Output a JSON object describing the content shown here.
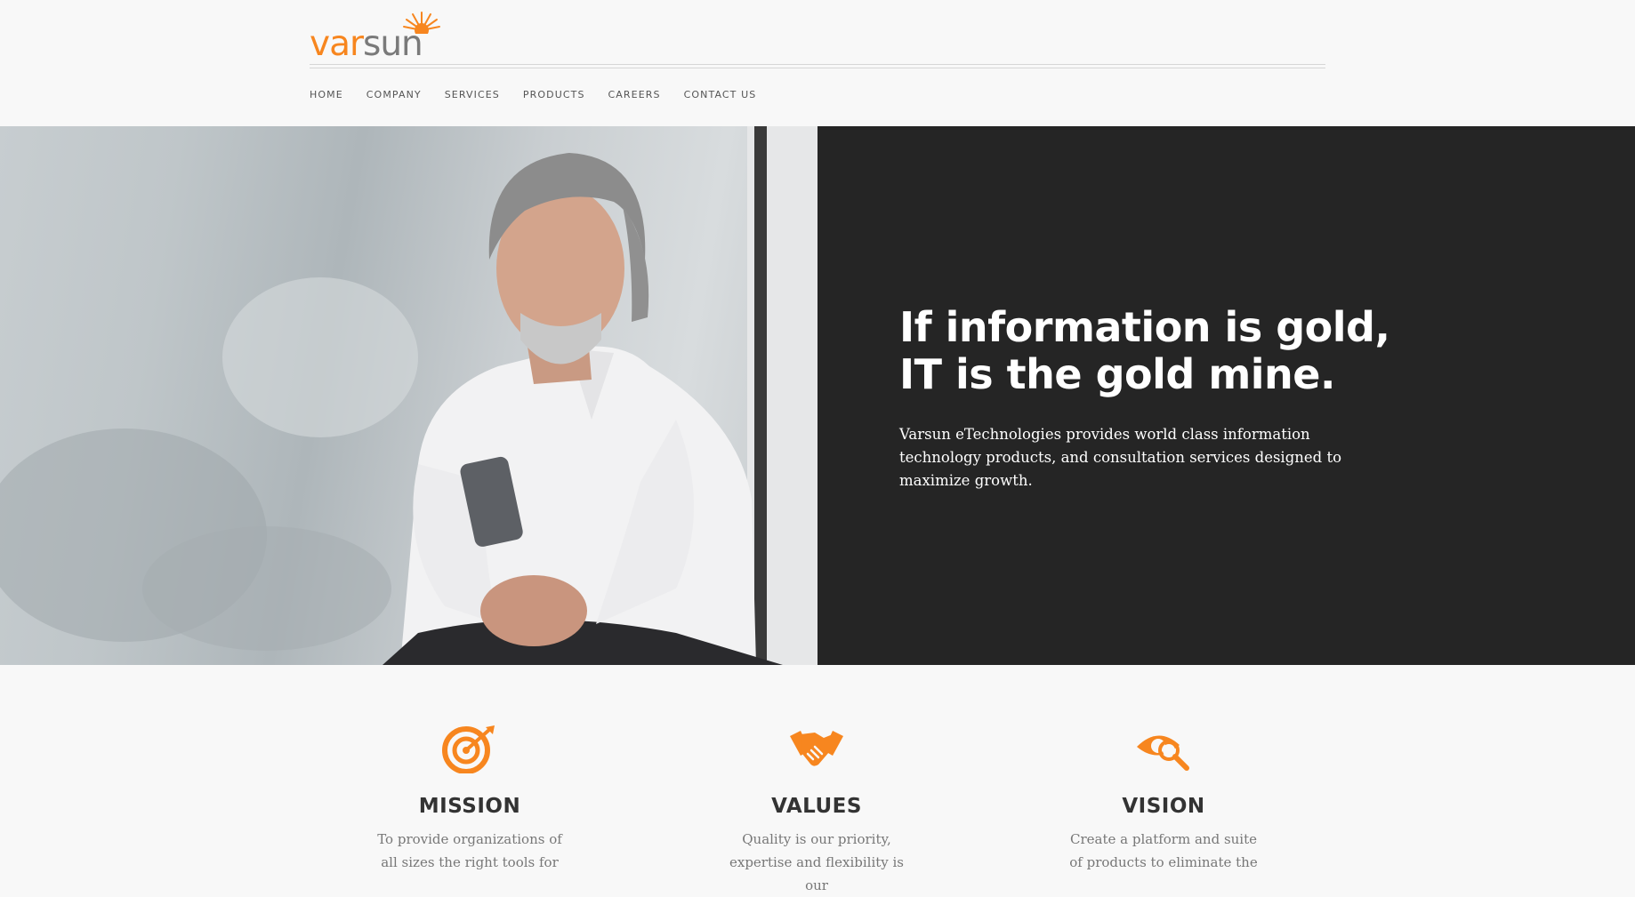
{
  "brand": {
    "logo_part1": "var",
    "logo_part2": "sun",
    "accent_color": "#f7861f",
    "gray_color": "#7a7a7a"
  },
  "nav": {
    "items": [
      {
        "label": "HOME"
      },
      {
        "label": "COMPANY"
      },
      {
        "label": "SERVICES"
      },
      {
        "label": "PRODUCTS"
      },
      {
        "label": "CAREERS"
      },
      {
        "label": "CONTACT US"
      }
    ]
  },
  "hero": {
    "headline": "If information is gold, IT is the gold mine.",
    "description": "Varsun eTechnologies provides world class information technology products, and consultation services designed to maximize growth.",
    "dark_panel_color": "#252525"
  },
  "features": [
    {
      "icon": "target-icon",
      "title": "MISSION",
      "text": "To provide organizations of all sizes the right tools for"
    },
    {
      "icon": "handshake-icon",
      "title": "VALUES",
      "text": "Quality is our priority, expertise and flexibility is our"
    },
    {
      "icon": "eye-search-icon",
      "title": "VISION",
      "text": "Create a platform and suite of products to eliminate the"
    }
  ]
}
